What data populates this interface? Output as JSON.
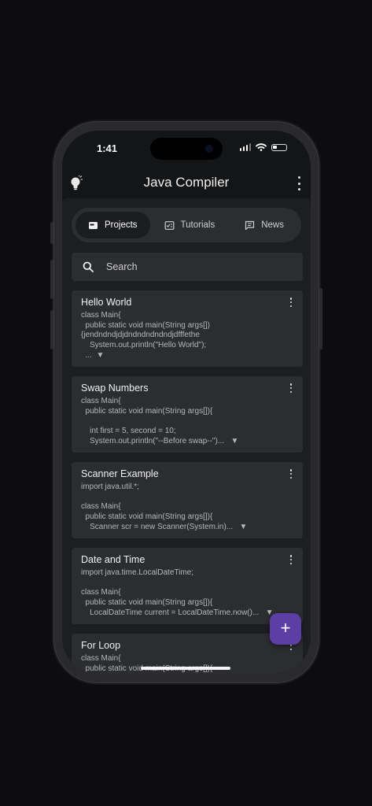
{
  "status_bar": {
    "time": "1:41"
  },
  "app": {
    "title": "Java Compiler"
  },
  "tabs": [
    {
      "label": "Projects",
      "icon": "folder-icon",
      "active": true
    },
    {
      "label": "Tutorials",
      "icon": "tutorials-icon",
      "active": false
    },
    {
      "label": "News",
      "icon": "news-icon",
      "active": false
    }
  ],
  "search": {
    "placeholder": "Search"
  },
  "projects": [
    {
      "title": "Hello World",
      "code": "class Main{\n  public static void main(String args[])\n{jendndndjdjdndndndndndjdfffethe\n    System.out.println(\"Hello World\");\n  ...  ▼"
    },
    {
      "title": "Swap Numbers",
      "code": "class Main{\n  public static void main(String args[]){\n\n    int first = 5, second = 10;\n    System.out.println(\"--Before swap--\")...   ▼"
    },
    {
      "title": "Scanner Example",
      "code": "import java.util.*;\n\nclass Main{\n  public static void main(String args[]){\n    Scanner scr = new Scanner(System.in)...   ▼"
    },
    {
      "title": "Date and Time",
      "code": "import java.time.LocalDateTime;\n\nclass Main{\n  public static void main(String args[]){\n    LocalDateTime current = LocalDateTime.now()...   ▼"
    },
    {
      "title": "For Loop",
      "code": "class Main{\n  public static void main(String args[]){"
    }
  ],
  "fab": {
    "label": "+"
  },
  "colors": {
    "accent": "#5b3fa5",
    "background": "#1d1e21",
    "card": "#2b2d31"
  }
}
